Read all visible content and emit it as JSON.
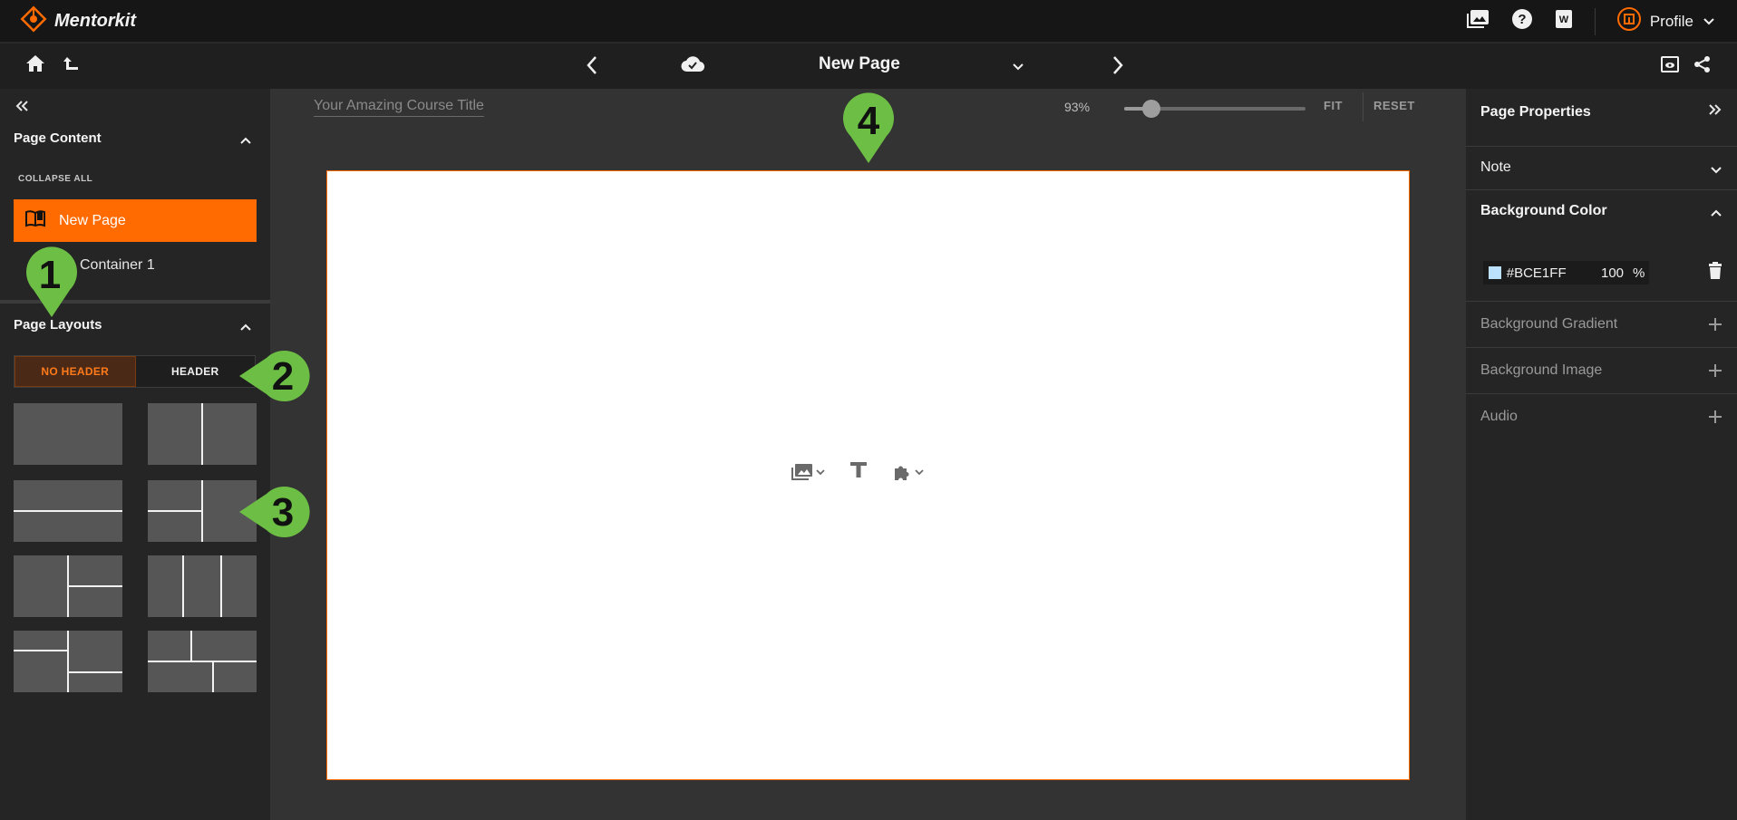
{
  "app": {
    "name": "Mentorkit"
  },
  "colors": {
    "accent": "#FF6B00",
    "marker": "#6DBE45",
    "panel": "#252525",
    "canvas_bg": "#333333"
  },
  "topbar": {
    "icons": [
      "media-library-icon",
      "help-icon",
      "word-doc-icon",
      "profile-avatar-icon"
    ],
    "profile_label": "Profile"
  },
  "toolbar": {
    "page_title": "New Page"
  },
  "left_panel": {
    "page_content_title": "Page Content",
    "collapse_all": "COLLAPSE ALL",
    "tree": {
      "active_item": "New Page",
      "child_item": "Container 1"
    },
    "page_layouts_title": "Page Layouts",
    "layout_tabs": {
      "no_header": "NO HEADER",
      "header": "HEADER"
    }
  },
  "canvas": {
    "course_title_placeholder": "Your Amazing Course Title",
    "zoom": "93%",
    "zoom_level": 0.15,
    "fit_label": "FIT",
    "reset_label": "RESET"
  },
  "right_panel": {
    "title": "Page Properties",
    "note": "Note",
    "background_color": "Background Color",
    "color_value": "#BCE1FF",
    "opacity_value": "100",
    "percent": "%",
    "background_gradient": "Background Gradient",
    "background_image": "Background Image",
    "audio": "Audio"
  },
  "markers": {
    "m1": "1",
    "m2": "2",
    "m3": "3",
    "m4": "4"
  }
}
